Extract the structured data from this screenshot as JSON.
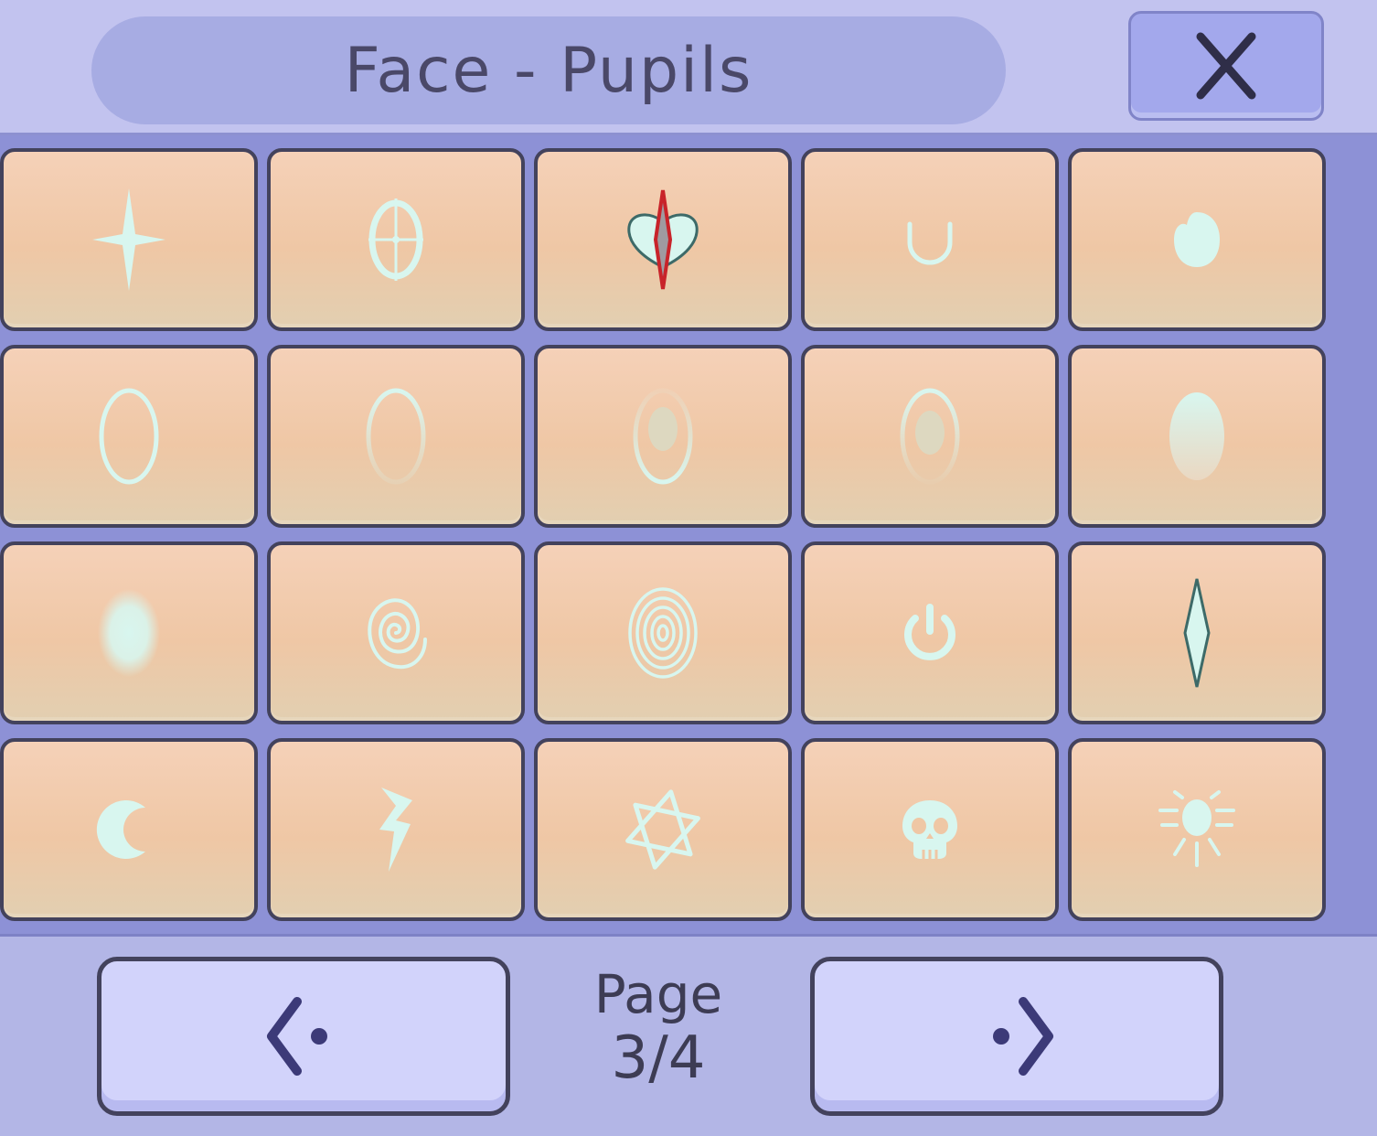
{
  "header": {
    "title": "Face - Pupils",
    "close_label": "X"
  },
  "pupil_options": [
    {
      "icon": "four-point-star-icon"
    },
    {
      "icon": "crosshair-ring-icon"
    },
    {
      "icon": "heart-with-slit-icon"
    },
    {
      "icon": "u-curve-icon"
    },
    {
      "icon": "blob-icon"
    },
    {
      "icon": "thin-ring-icon"
    },
    {
      "icon": "faded-ring-icon"
    },
    {
      "icon": "ring-with-dot-icon"
    },
    {
      "icon": "faded-ring-with-dot-icon"
    },
    {
      "icon": "gradient-oval-icon"
    },
    {
      "icon": "soft-glow-oval-icon"
    },
    {
      "icon": "spiral-icon"
    },
    {
      "icon": "concentric-rings-icon"
    },
    {
      "icon": "power-symbol-icon"
    },
    {
      "icon": "diamond-slit-icon"
    },
    {
      "icon": "crescent-moon-icon"
    },
    {
      "icon": "lightning-bolt-icon"
    },
    {
      "icon": "hexagram-star-icon"
    },
    {
      "icon": "skull-icon"
    },
    {
      "icon": "sun-rays-icon"
    }
  ],
  "pagination": {
    "page_word": "Page",
    "page_number": "3/4",
    "prev_icon": "chevron-left-dot-icon",
    "next_icon": "chevron-right-dot-icon"
  },
  "colors": {
    "tile_top": "#f5d1b8",
    "tile_bottom": "#e2cfb1",
    "icon_mint": "#d8f6ef",
    "outline": "#43425c",
    "grid_bg": "#8d91d6",
    "header_bg": "#c2c3ef",
    "button_bg": "#d2d3fb"
  }
}
